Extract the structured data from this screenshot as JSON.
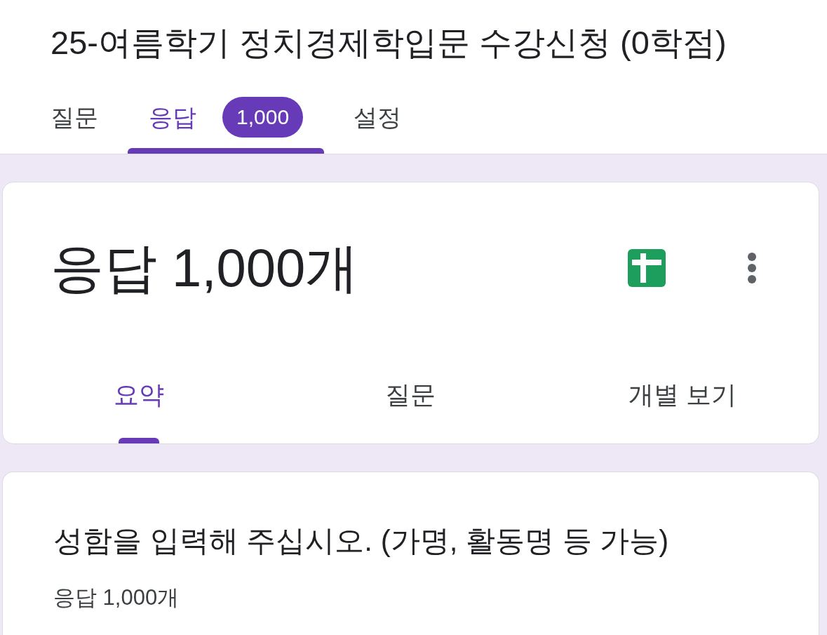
{
  "form_title": "25-여름학기 정치경제학입문 수강신청 (0학점)",
  "tabs": [
    {
      "label": "질문",
      "selected": false
    },
    {
      "label": "응답",
      "selected": true,
      "badge": "1,000"
    },
    {
      "label": "설정",
      "selected": false
    }
  ],
  "summary_card": {
    "heading": "응답 1,000개",
    "tabs": [
      {
        "label": "요약",
        "selected": true
      },
      {
        "label": "질문",
        "selected": false
      },
      {
        "label": "개별 보기",
        "selected": false
      }
    ]
  },
  "question_card": {
    "title": "성함을 입력해 주십시오. (가명, 활동명 등 가능)",
    "response_count": "응답 1,000개"
  }
}
